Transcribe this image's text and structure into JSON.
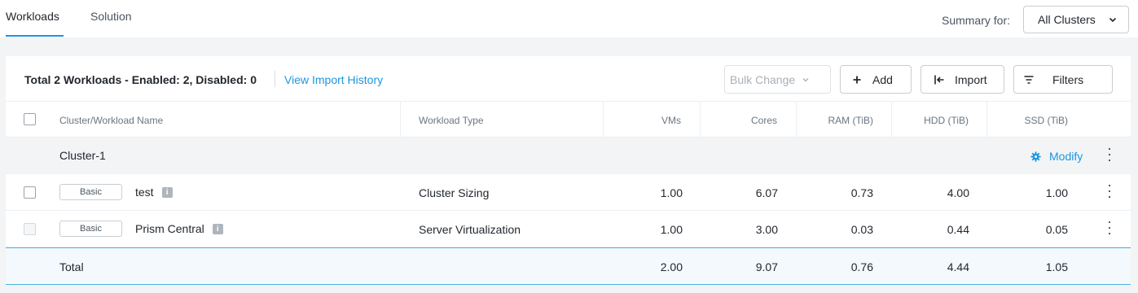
{
  "tabs": [
    {
      "label": "Workloads",
      "active": true
    },
    {
      "label": "Solution",
      "active": false
    }
  ],
  "summary": {
    "label": "Summary for:",
    "selected": "All Clusters"
  },
  "toolbar": {
    "total_text": "Total 2 Workloads - Enabled: 2, Disabled: 0",
    "import_history": "View Import History",
    "bulk_change": "Bulk Change",
    "add": "Add",
    "import": "Import",
    "filters": "Filters"
  },
  "table": {
    "headers": {
      "name": "Cluster/Workload Name",
      "type": "Workload Type",
      "vms": "VMs",
      "cores": "Cores",
      "ram": "RAM (TiB)",
      "hdd": "HDD (TiB)",
      "ssd": "SSD (TiB)"
    },
    "group": {
      "name": "Cluster-1",
      "modify": "Modify"
    },
    "rows": [
      {
        "badge": "Basic",
        "name": "test",
        "type": "Cluster Sizing",
        "vms": "1.00",
        "cores": "6.07",
        "ram": "0.73",
        "hdd": "4.00",
        "ssd": "1.00"
      },
      {
        "badge": "Basic",
        "name": "Prism Central",
        "type": "Server Virtualization",
        "vms": "1.00",
        "cores": "3.00",
        "ram": "0.03",
        "hdd": "0.44",
        "ssd": "0.05"
      }
    ],
    "total": {
      "label": "Total",
      "vms": "2.00",
      "cores": "9.07",
      "ram": "0.76",
      "hdd": "4.44",
      "ssd": "1.05"
    }
  },
  "icons": {
    "info": "i",
    "accent_color": "#1b96e0"
  }
}
